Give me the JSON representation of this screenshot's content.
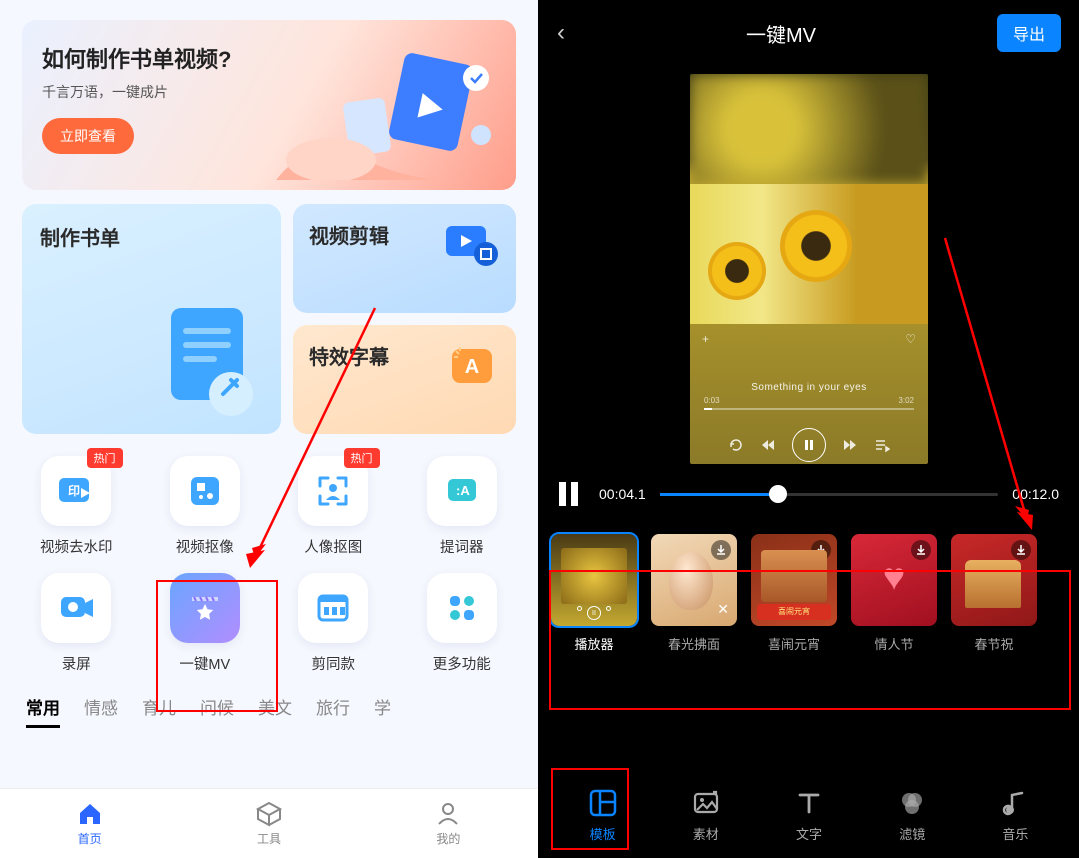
{
  "left": {
    "banner": {
      "title": "如何制作书单视频?",
      "sub": "千言万语，一键成片",
      "btn": "立即查看"
    },
    "card_big": "制作书单",
    "card_video": "视频剪辑",
    "card_text": "特效字幕",
    "hot_badge": "热门",
    "tools": [
      {
        "label": "视频去水印"
      },
      {
        "label": "视频抠像"
      },
      {
        "label": "人像抠图"
      },
      {
        "label": "提词器"
      },
      {
        "label": "录屏"
      },
      {
        "label": "一键MV"
      },
      {
        "label": "剪同款"
      },
      {
        "label": "更多功能"
      }
    ],
    "tabs": [
      "常用",
      "情感",
      "育儿",
      "问候",
      "美文",
      "旅行",
      "学"
    ],
    "nav": [
      "首页",
      "工具",
      "我的"
    ]
  },
  "right": {
    "title": "一键MV",
    "export": "导出",
    "lyric": "Something in your eyes",
    "preview_time_a": "0:03",
    "preview_time_b": "3:02",
    "time_cur": "00:04.1",
    "time_total": "00:12.0",
    "templates": [
      "播放器",
      "春光拂面",
      "喜闹元宵",
      "情人节",
      "春节祝"
    ],
    "tabs": [
      "模板",
      "素材",
      "文字",
      "滤镜",
      "音乐"
    ]
  }
}
